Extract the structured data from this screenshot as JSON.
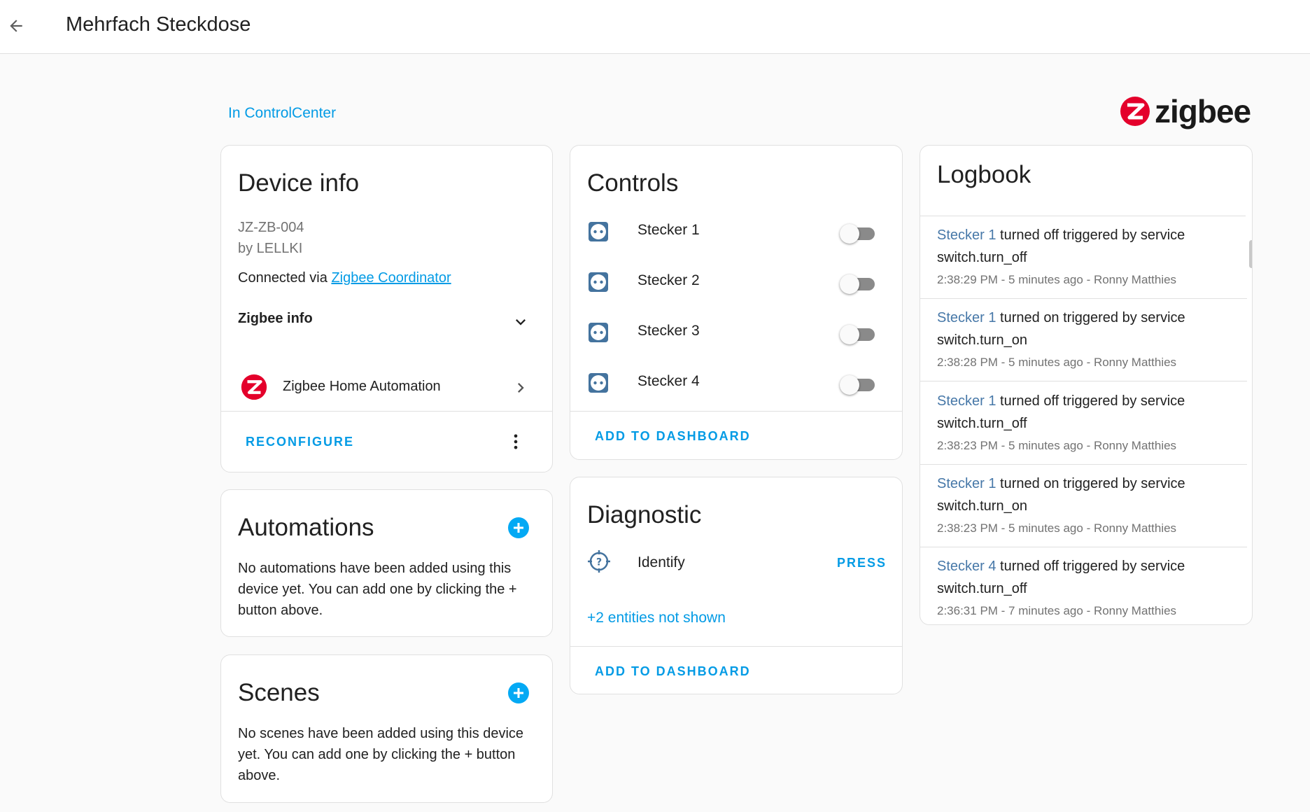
{
  "header": {
    "title": "Mehrfach Steckdose"
  },
  "area": {
    "label": "In ControlCenter"
  },
  "brand": {
    "name": "zigbee",
    "color": "#e4002b"
  },
  "device_info": {
    "title": "Device info",
    "model": "JZ-ZB-004",
    "manufacturer": "by LELLKI",
    "connected_prefix": "Connected via",
    "connected_link": "Zigbee Coordinator",
    "zigbee_info_label": "Zigbee info",
    "integration": "Zigbee Home Automation",
    "reconfigure": "RECONFIGURE"
  },
  "automations": {
    "title": "Automations",
    "empty_text": "No automations have been added using this device yet. You can add one by clicking the + button above."
  },
  "scenes": {
    "title": "Scenes",
    "empty_text": "No scenes have been added using this device yet. You can add one by clicking the + button above."
  },
  "controls": {
    "title": "Controls",
    "entities": [
      {
        "name": "Stecker 1",
        "state": "off"
      },
      {
        "name": "Stecker 2",
        "state": "off"
      },
      {
        "name": "Stecker 3",
        "state": "off"
      },
      {
        "name": "Stecker 4",
        "state": "off"
      }
    ],
    "add_to_dashboard": "ADD TO DASHBOARD"
  },
  "diagnostic": {
    "title": "Diagnostic",
    "entity_name": "Identify",
    "press_label": "PRESS",
    "hidden_entities": "+2 entities not shown",
    "add_to_dashboard": "ADD TO DASHBOARD"
  },
  "logbook": {
    "title": "Logbook",
    "entries": [
      {
        "entity": "Stecker 1",
        "action": "turned off triggered by service",
        "service": "switch.turn_off",
        "meta": "2:38:29 PM - 5 minutes ago - Ronny Matthies"
      },
      {
        "entity": "Stecker 1",
        "action": "turned on triggered by service",
        "service": "switch.turn_on",
        "meta": "2:38:28 PM - 5 minutes ago - Ronny Matthies"
      },
      {
        "entity": "Stecker 1",
        "action": "turned off triggered by service",
        "service": "switch.turn_off",
        "meta": "2:38:23 PM - 5 minutes ago - Ronny Matthies"
      },
      {
        "entity": "Stecker 1",
        "action": "turned on triggered by service",
        "service": "switch.turn_on",
        "meta": "2:38:23 PM - 5 minutes ago - Ronny Matthies"
      },
      {
        "entity": "Stecker 4",
        "action": "turned off triggered by service",
        "service": "switch.turn_off",
        "meta": "2:36:31 PM - 7 minutes ago - Ronny Matthies"
      }
    ]
  },
  "colors": {
    "accent": "#03a9f4",
    "link": "#039be5",
    "entity_icon": "#44739e"
  }
}
